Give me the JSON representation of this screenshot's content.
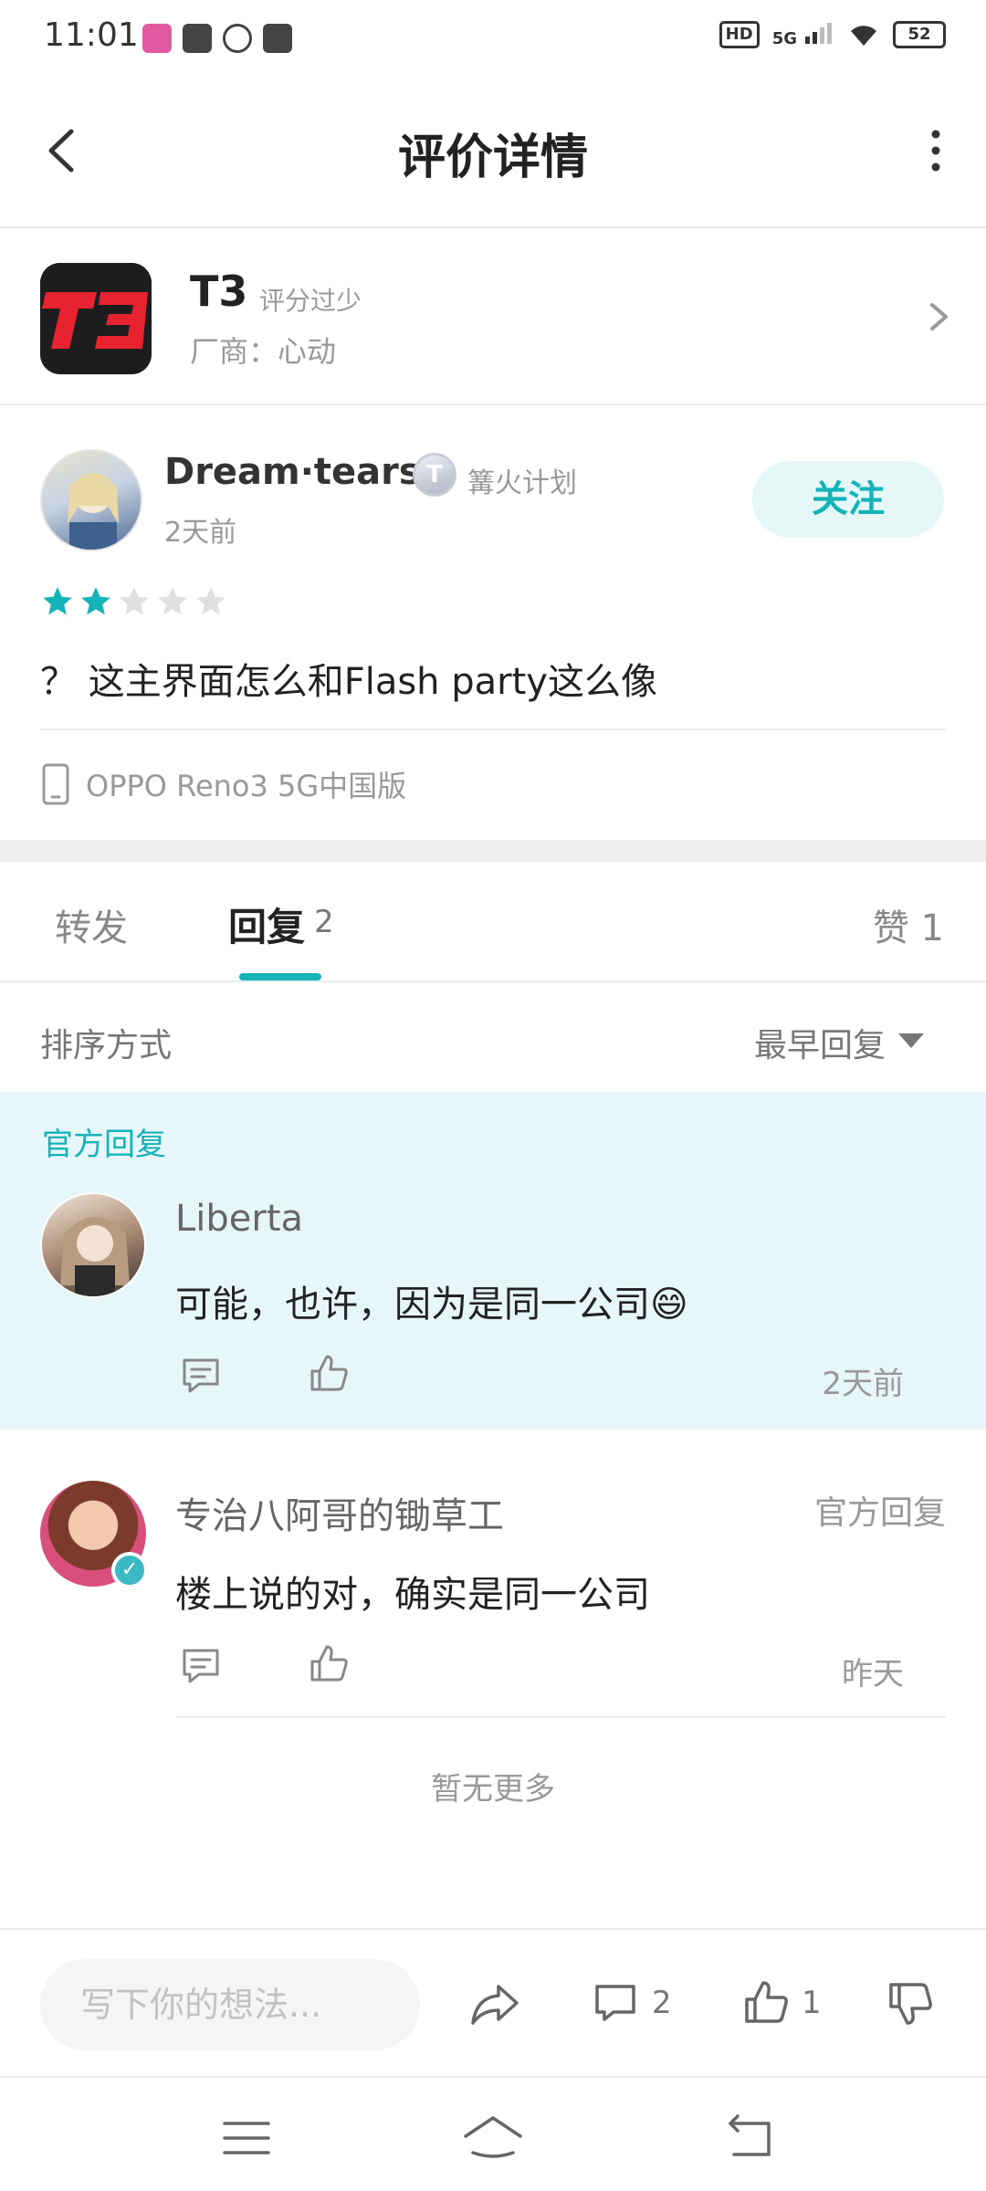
{
  "status_bar": {
    "time": "11:01",
    "network": "5G",
    "hd": "HD",
    "battery": "52"
  },
  "header": {
    "title": "评价详情"
  },
  "game": {
    "name": "T3",
    "score_text": "评分过少",
    "vendor": "厂商：心动",
    "icon_label": "T3"
  },
  "review": {
    "username": "Dream·tears",
    "level_badge": "T",
    "badge_text": "篝火计划",
    "time": "2天前",
    "follow_label": "关注",
    "rating": 2,
    "rating_max": 5,
    "text": "？ 这主界面怎么和Flash party这么像",
    "device": "OPPO Reno3 5G中国版"
  },
  "tabs": {
    "forward": "转发",
    "reply": "回复",
    "reply_count": "2",
    "likes": "赞 1"
  },
  "sort": {
    "label": "排序方式",
    "value": "最早回复"
  },
  "replies": [
    {
      "tag": "官方回复",
      "name": "Liberta",
      "text": "可能，也许，因为是同一公司😄",
      "time": "2天前"
    },
    {
      "tag": "官方回复",
      "name": "专治八阿哥的锄草工",
      "text": "楼上说的对，确实是同一公司",
      "time": "昨天"
    }
  ],
  "no_more": "暂无更多",
  "action_bar": {
    "placeholder": "写下你的想法...",
    "comment_count": "2",
    "like_count": "1"
  },
  "colors": {
    "accent": "#14b3b8",
    "official_bg": "#e6f6f9",
    "game_icon_red": "#e8232f"
  }
}
